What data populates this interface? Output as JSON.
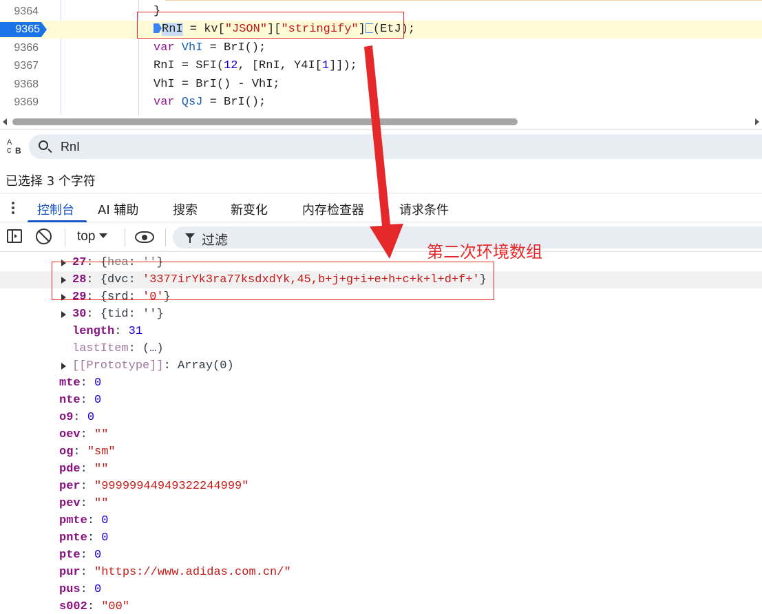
{
  "editor": {
    "lines": [
      {
        "number": "9364",
        "code_html_key": "l9364"
      },
      {
        "number": "9365",
        "code_html_key": "l9365"
      },
      {
        "number": "9366",
        "code_html_key": "l9366"
      },
      {
        "number": "9367",
        "code_html_key": "l9367"
      },
      {
        "number": "9368",
        "code_html_key": "l9368"
      },
      {
        "number": "9369",
        "code_html_key": "l9369"
      }
    ],
    "line_numbers": [
      "9364",
      "9365",
      "9366",
      "9367",
      "9368",
      "9369"
    ],
    "active_line": "9365",
    "code": {
      "l9364": "}",
      "l9365_a": "RnI",
      "l9365_b": " = kv[",
      "l9365_c": "\"JSON\"",
      "l9365_d": "][",
      "l9365_e": "\"stringify\"",
      "l9365_f": "]",
      "l9365_g": "(EtJ);",
      "l9366_kw": "var",
      "l9366_var": " VhI",
      "l9366_rest": " = BrI();",
      "l9367_a": "RnI = SFI(",
      "l9367_num": "12",
      "l9367_b": ", [RnI, Y4I[",
      "l9367_num2": "1",
      "l9367_c": "]]);",
      "l9368": "VhI = BrI() - VhI;",
      "l9369_kw": "var",
      "l9369_var": " QsJ",
      "l9369_rest": " = BrI();"
    }
  },
  "search": {
    "query": "RnI",
    "case_toggle": {
      "a": "A",
      "c": "c",
      "b": "B"
    }
  },
  "selection_status": "已选择 3 个字符",
  "drawer_tabs": [
    {
      "label": "控制台",
      "active": true
    },
    {
      "label": "AI 辅助",
      "active": false
    },
    {
      "label": "搜索",
      "active": false
    },
    {
      "label": "新变化",
      "active": false
    },
    {
      "label": "内存检查器",
      "active": false
    },
    {
      "label": "请求条件",
      "active": false
    }
  ],
  "console_toolbar": {
    "context": "top",
    "filter_label": "过滤"
  },
  "annotation": "第二次环境数组",
  "console": {
    "array_items": [
      {
        "index": "27",
        "key": "hea",
        "value": "''"
      },
      {
        "index": "28",
        "key": "dvc",
        "value": "'3377irYk3ra77ksdxdYk,45,b+j+g+i+e+h+c+k+l+d+f+'"
      },
      {
        "index": "29",
        "key": "srd",
        "value": "'0'"
      },
      {
        "index": "30",
        "key": "tid",
        "value": "''"
      }
    ],
    "length_label": "length",
    "length_value": "31",
    "last_item_label": "lastItem",
    "last_item_value": "(…)",
    "prototype_label": "[[Prototype]]",
    "prototype_value": "Array(0)",
    "props": [
      {
        "key": "mte",
        "value": "0",
        "type": "num"
      },
      {
        "key": "nte",
        "value": "0",
        "type": "num"
      },
      {
        "key": "o9",
        "value": "0",
        "type": "num"
      },
      {
        "key": "oev",
        "value": "\"\"",
        "type": "str"
      },
      {
        "key": "og",
        "value": "\"sm\"",
        "type": "str"
      },
      {
        "key": "pde",
        "value": "\"\"",
        "type": "str"
      },
      {
        "key": "per",
        "value": "\"99999944949322244999\"",
        "type": "str"
      },
      {
        "key": "pev",
        "value": "\"\"",
        "type": "str"
      },
      {
        "key": "pmte",
        "value": "0",
        "type": "num"
      },
      {
        "key": "pnte",
        "value": "0",
        "type": "num"
      },
      {
        "key": "pte",
        "value": "0",
        "type": "num"
      },
      {
        "key": "pur",
        "value": "\"https://www.adidas.com.cn/\"",
        "type": "str"
      },
      {
        "key": "pus",
        "value": "0",
        "type": "num"
      },
      {
        "key": "s002",
        "value": "\"00\"",
        "type": "str"
      }
    ]
  },
  "colors": {
    "accent": "#1a73e8",
    "annotation_red": "#e5282a",
    "property_key": "#881280",
    "string_value": "#c41a16",
    "number_value": "#1c00cf"
  }
}
